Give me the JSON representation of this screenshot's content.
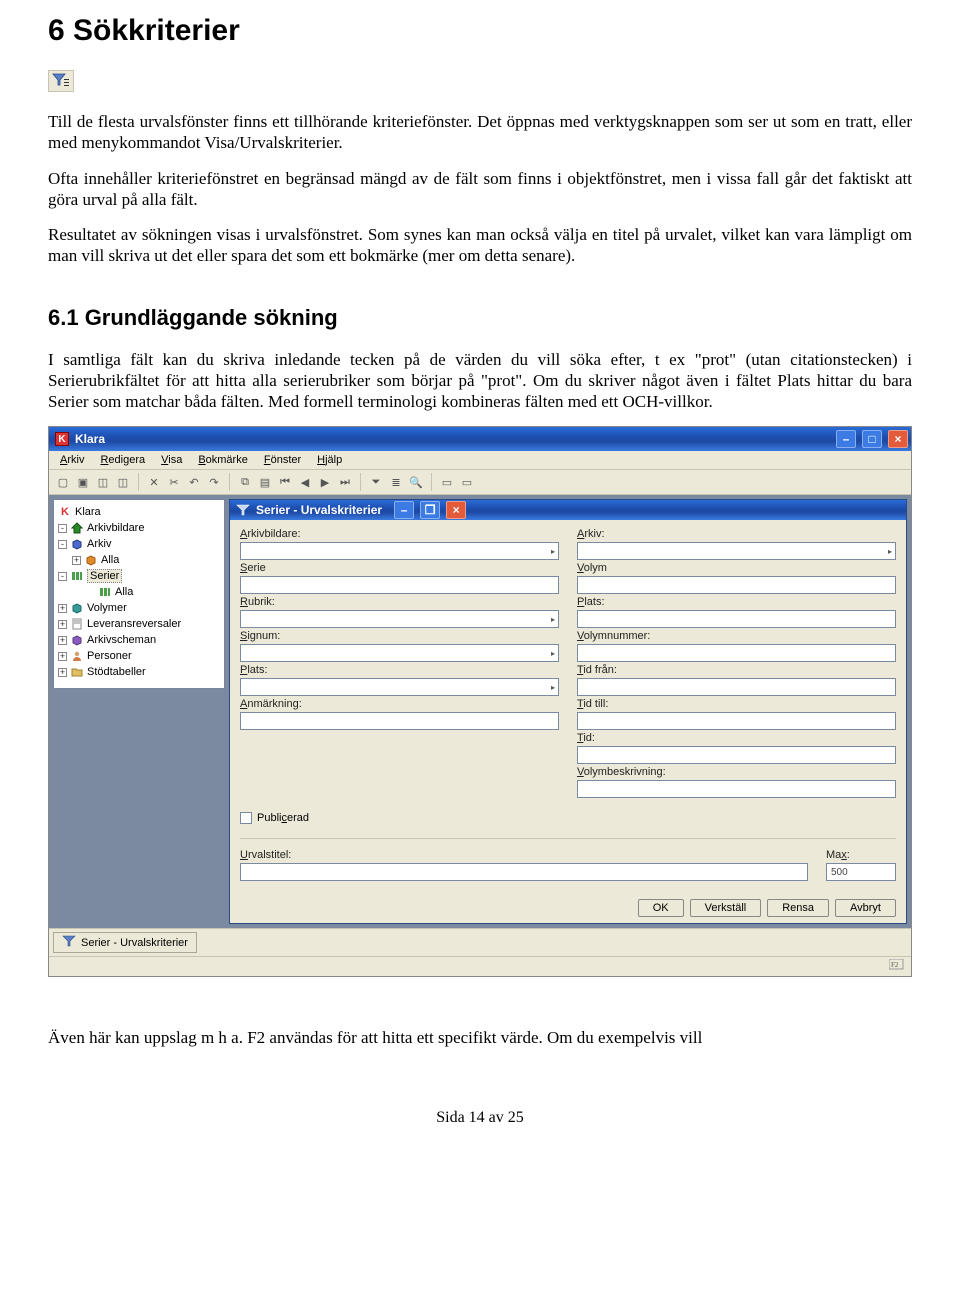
{
  "heading": "6   Sökkriterier",
  "para1": "Till de flesta urvalsfönster finns ett tillhörande kriteriefönster. Det öppnas med verktygsknappen som ser ut som en tratt, eller med menykommandot Visa/Urvalskriterier.",
  "para2": "Ofta innehåller kriteriefönstret en begränsad mängd av de fält som finns i objektfönstret, men i vissa fall går det faktiskt att göra urval på alla fält.",
  "para3": "Resultatet av sökningen visas i urvalsfönstret. Som synes kan man också välja en titel på urvalet, vilket kan vara lämpligt om man vill skriva ut det eller spara det som ett bokmärke (mer om detta senare).",
  "subheading": "6.1   Grundläggande sökning",
  "para4": "I samtliga fält kan du skriva inledande tecken på de värden du vill söka efter, t ex \"prot\" (utan citationstecken) i Serierubrikfältet för att hitta alla serierubriker som börjar på \"prot\". Om du skriver något även i fältet Plats hittar du bara Serier som matchar båda fälten. Med formell terminologi kombineras fälten med ett OCH-villkor.",
  "para5": "Även här kan uppslag m h a. F2 användas för att hitta ett specifikt värde. Om du exempelvis vill",
  "footer": "Sida 14 av 25",
  "app": {
    "title": "Klara",
    "menu": [
      "Arkiv",
      "Redigera",
      "Visa",
      "Bokmärke",
      "Fönster",
      "Hjälp"
    ],
    "tree": {
      "root": "Klara",
      "items": [
        {
          "twist": "-",
          "icon": "home",
          "label": "Arkivbildare"
        },
        {
          "twist": "-",
          "icon": "cube-blue",
          "label": "Arkiv"
        },
        {
          "twist": "+",
          "icon": "cube-orange",
          "label": "Alla",
          "indent": 1
        },
        {
          "twist": "-",
          "icon": "bars-green",
          "label": "Serier",
          "indent": 0,
          "sel": true
        },
        {
          "twist": " ",
          "icon": "bars-green",
          "label": "Alla",
          "indent": 2
        },
        {
          "twist": "+",
          "icon": "cube-teal",
          "label": "Volymer"
        },
        {
          "twist": "+",
          "icon": "doc",
          "label": "Leveransreversaler"
        },
        {
          "twist": "+",
          "icon": "cube-purple",
          "label": "Arkivscheman"
        },
        {
          "twist": "+",
          "icon": "person",
          "label": "Personer"
        },
        {
          "twist": "+",
          "icon": "folder",
          "label": "Stödtabeller"
        }
      ]
    },
    "inner": {
      "title": "Serier - Urvalskriterier",
      "fields_left": [
        {
          "label": "Arkivbildare:",
          "kind": "drop"
        },
        {
          "label": "Serie",
          "kind": "plain"
        },
        {
          "label": "Rubrik:",
          "kind": "drop"
        },
        {
          "label": "Signum:",
          "kind": "drop"
        },
        {
          "label": "Plats:",
          "kind": "drop"
        },
        {
          "label": "Anmärkning:",
          "kind": "plain"
        }
      ],
      "fields_right": [
        {
          "label": "Arkiv:",
          "kind": "drop"
        },
        {
          "label": "Volym",
          "kind": "plain"
        },
        {
          "label": "Plats:",
          "kind": "plain"
        },
        {
          "label": "Volymnummer:",
          "kind": "plain"
        },
        {
          "label": "Tid från:",
          "kind": "plain"
        },
        {
          "label": "Tid till:",
          "kind": "plain"
        },
        {
          "label": "Tid:",
          "kind": "plain"
        },
        {
          "label": "Volymbeskrivning:",
          "kind": "plain"
        }
      ],
      "checkbox": "Publicerad",
      "urval_label": "Urvalstitel:",
      "max_label": "Max:",
      "max_value": "500",
      "buttons": [
        "OK",
        "Verkställ",
        "Rensa",
        "Avbryt"
      ]
    },
    "taskbar": "Serier - Urvalskriterier",
    "f2": "F2"
  }
}
